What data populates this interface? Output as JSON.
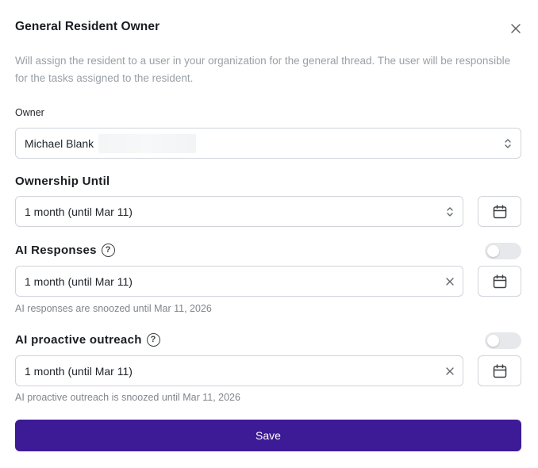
{
  "dialog": {
    "title": "General Resident Owner",
    "description": "Will assign the resident to a user in your organization for the general thread. The user will be responsible for the tasks assigned to the resident."
  },
  "owner": {
    "label": "Owner",
    "value": "Michael Blank",
    "icon": "chevron-updown-icon"
  },
  "ownership_until": {
    "label": "Ownership Until",
    "value": "1 month (until Mar 11)",
    "icon": "chevron-updown-icon",
    "calendar_icon": "calendar-icon"
  },
  "ai_responses": {
    "label": "AI Responses",
    "help_glyph": "?",
    "toggle_on": false,
    "value": "1 month (until Mar 11)",
    "clear_icon": "x-icon",
    "calendar_icon": "calendar-icon",
    "hint": "AI responses are snoozed until Mar 11, 2026"
  },
  "ai_outreach": {
    "label": "AI proactive outreach",
    "help_glyph": "?",
    "toggle_on": false,
    "value": "1 month (until Mar 11)",
    "clear_icon": "x-icon",
    "calendar_icon": "calendar-icon",
    "hint": "AI proactive outreach is snoozed until Mar 11, 2026"
  },
  "actions": {
    "save_label": "Save"
  },
  "colors": {
    "primary": "#3d1a96",
    "toggle_off": "#e6e8eb",
    "border": "#d0d4d9",
    "muted_text": "#9aa0a6"
  }
}
